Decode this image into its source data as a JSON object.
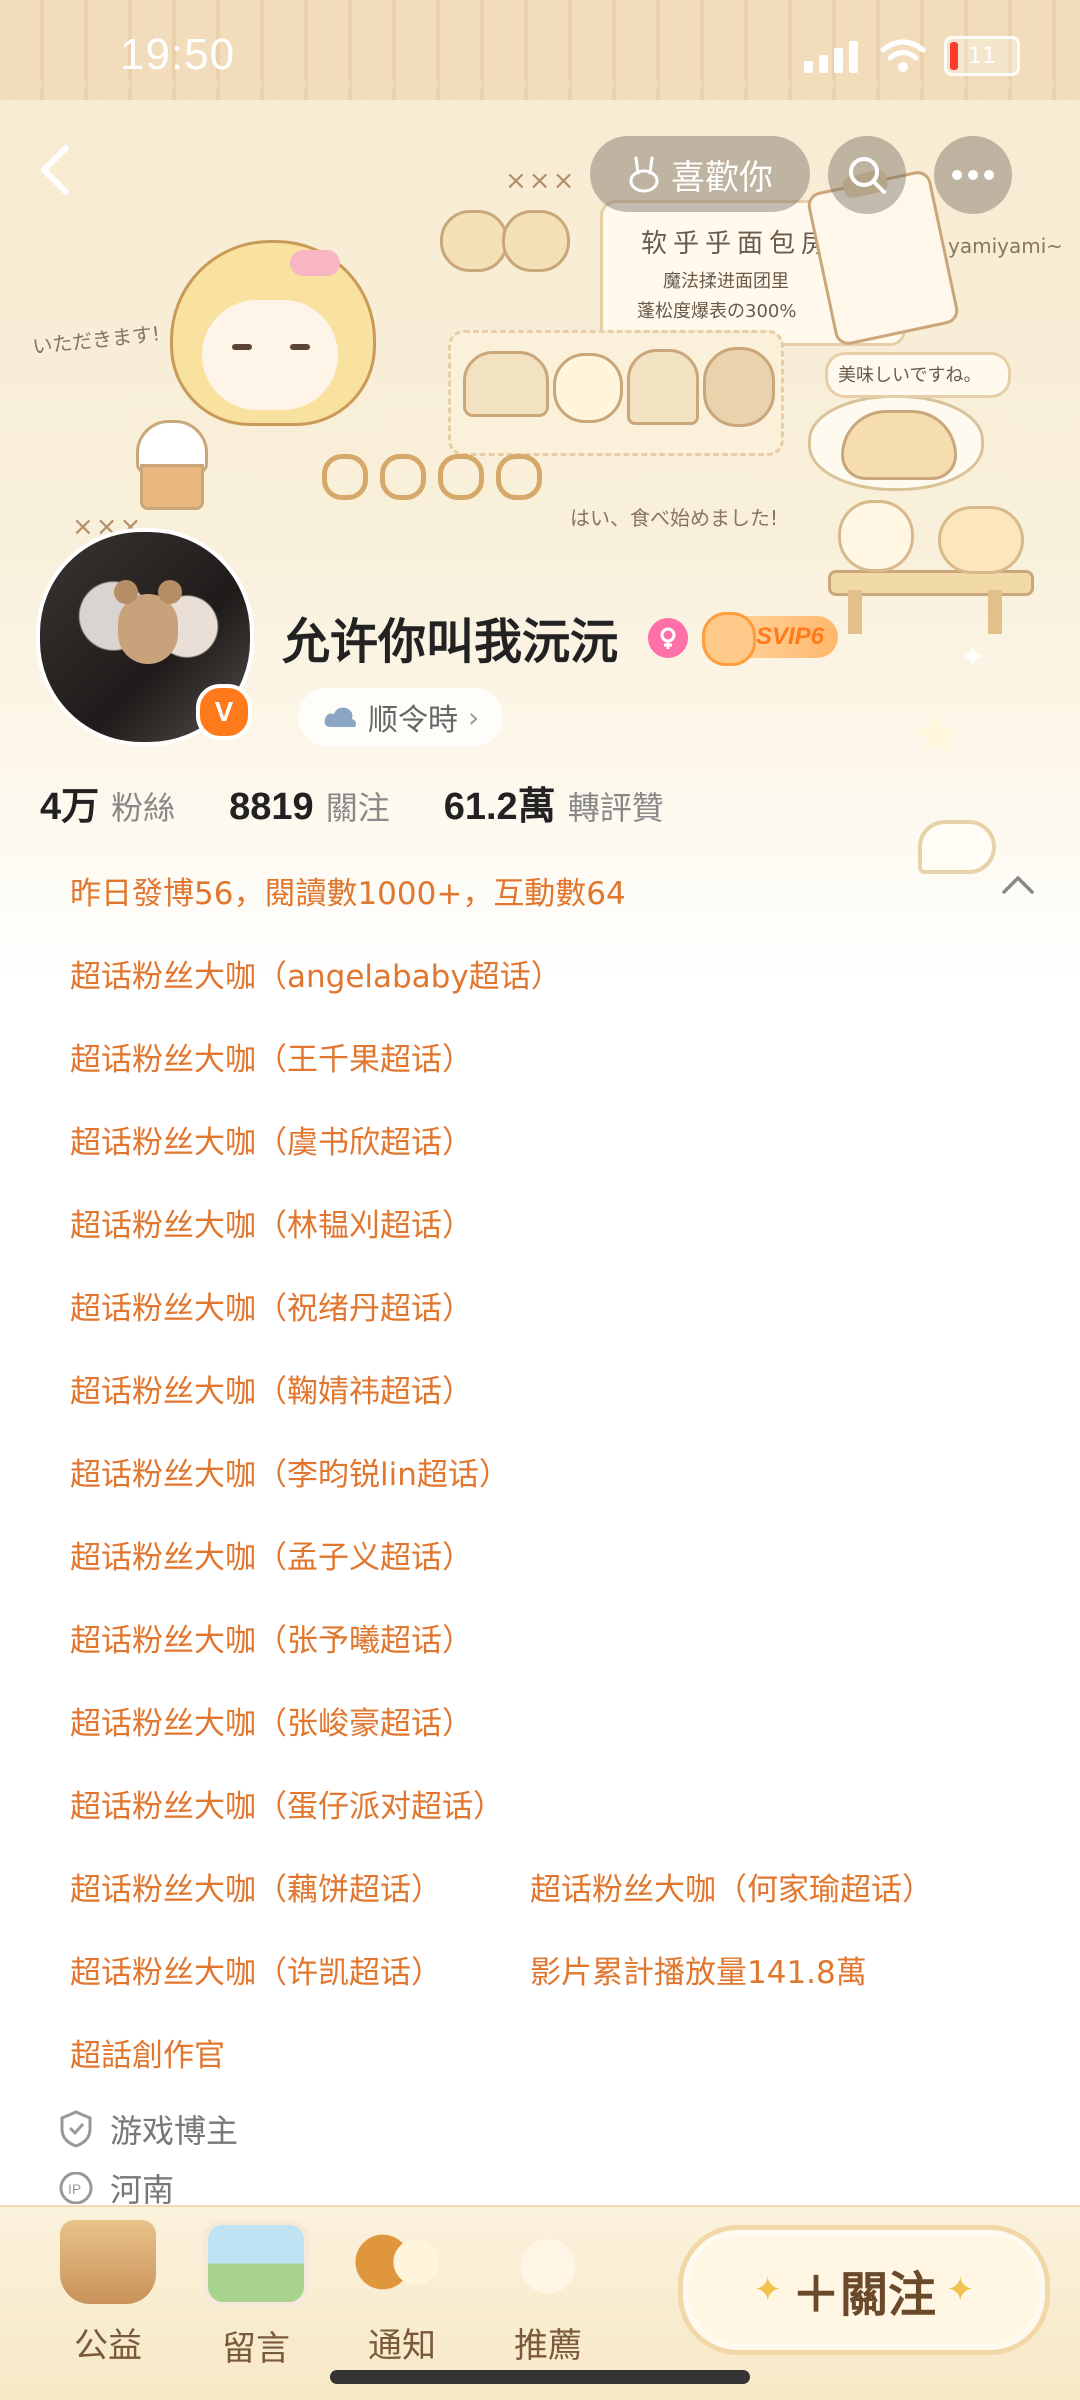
{
  "status_bar": {
    "time": "19:50",
    "battery": "11"
  },
  "nav": {
    "like_label": "喜歡你"
  },
  "banner_text": {
    "shop_title": "软乎乎面包房",
    "line1": "魔法揉进面团里",
    "line2": "蓬松度爆表の300%",
    "itadakimasu": "いただきます!",
    "delicious": "美味しいですね。",
    "start_eating": "はい、食べ始めました!",
    "yamiyami": "yamiyami~",
    "xxx": "×××"
  },
  "profile": {
    "username": "允许你叫我沅沅",
    "svip": "SVIP6",
    "weather_label": "顺令時",
    "v_badge": "V"
  },
  "stats": {
    "followers_num": "4万",
    "followers_label": "粉絲",
    "following_num": "8819",
    "following_label": "關注",
    "likes_num": "61.2萬",
    "likes_label": "轉評贊"
  },
  "details": {
    "summary": "昨日發博56，閱讀數1000+，互動數64",
    "items": [
      "超话粉丝大咖（angelababy超话）",
      "超话粉丝大咖（王千果超话）",
      "超话粉丝大咖（虞书欣超话）",
      "超话粉丝大咖（林韫刈超话）",
      "超话粉丝大咖（祝绪丹超话）",
      "超话粉丝大咖（鞠婧祎超话）",
      "超话粉丝大咖（李昀锐lin超话）",
      "超话粉丝大咖（孟子义超话）",
      "超话粉丝大咖（张予曦超话）",
      "超话粉丝大咖（张峻豪超话）",
      "超话粉丝大咖（蛋仔派对超话）",
      "超话粉丝大咖（藕饼超话）",
      "超话粉丝大咖（何家瑜超话）",
      "超话粉丝大咖（许凯超话）",
      "影片累計播放量141.8萬",
      "超話創作官"
    ],
    "tag_game": "游戏博主",
    "tag_location": "河南"
  },
  "bottom_bar": {
    "tools": [
      "公益",
      "留言",
      "通知",
      "推薦"
    ],
    "follow": "＋關注"
  },
  "colors": {
    "accent_orange": "#e1762e",
    "banner_cream": "#f7ebd0",
    "vip_orange": "#ff7a1a"
  }
}
